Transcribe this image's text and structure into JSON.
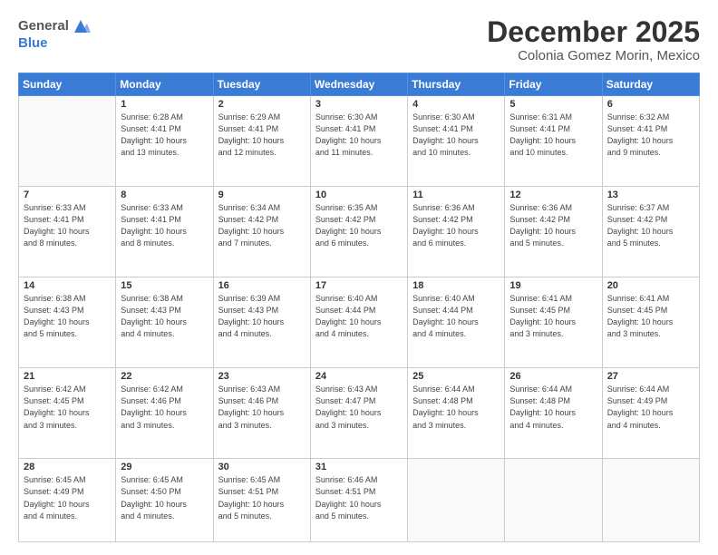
{
  "header": {
    "logo_general": "General",
    "logo_blue": "Blue",
    "month": "December 2025",
    "location": "Colonia Gomez Morin, Mexico"
  },
  "weekdays": [
    "Sunday",
    "Monday",
    "Tuesday",
    "Wednesday",
    "Thursday",
    "Friday",
    "Saturday"
  ],
  "weeks": [
    [
      {
        "day": "",
        "info": ""
      },
      {
        "day": "1",
        "info": "Sunrise: 6:28 AM\nSunset: 4:41 PM\nDaylight: 10 hours\nand 13 minutes."
      },
      {
        "day": "2",
        "info": "Sunrise: 6:29 AM\nSunset: 4:41 PM\nDaylight: 10 hours\nand 12 minutes."
      },
      {
        "day": "3",
        "info": "Sunrise: 6:30 AM\nSunset: 4:41 PM\nDaylight: 10 hours\nand 11 minutes."
      },
      {
        "day": "4",
        "info": "Sunrise: 6:30 AM\nSunset: 4:41 PM\nDaylight: 10 hours\nand 10 minutes."
      },
      {
        "day": "5",
        "info": "Sunrise: 6:31 AM\nSunset: 4:41 PM\nDaylight: 10 hours\nand 10 minutes."
      },
      {
        "day": "6",
        "info": "Sunrise: 6:32 AM\nSunset: 4:41 PM\nDaylight: 10 hours\nand 9 minutes."
      }
    ],
    [
      {
        "day": "7",
        "info": "Sunrise: 6:33 AM\nSunset: 4:41 PM\nDaylight: 10 hours\nand 8 minutes."
      },
      {
        "day": "8",
        "info": "Sunrise: 6:33 AM\nSunset: 4:41 PM\nDaylight: 10 hours\nand 8 minutes."
      },
      {
        "day": "9",
        "info": "Sunrise: 6:34 AM\nSunset: 4:42 PM\nDaylight: 10 hours\nand 7 minutes."
      },
      {
        "day": "10",
        "info": "Sunrise: 6:35 AM\nSunset: 4:42 PM\nDaylight: 10 hours\nand 6 minutes."
      },
      {
        "day": "11",
        "info": "Sunrise: 6:36 AM\nSunset: 4:42 PM\nDaylight: 10 hours\nand 6 minutes."
      },
      {
        "day": "12",
        "info": "Sunrise: 6:36 AM\nSunset: 4:42 PM\nDaylight: 10 hours\nand 5 minutes."
      },
      {
        "day": "13",
        "info": "Sunrise: 6:37 AM\nSunset: 4:42 PM\nDaylight: 10 hours\nand 5 minutes."
      }
    ],
    [
      {
        "day": "14",
        "info": "Sunrise: 6:38 AM\nSunset: 4:43 PM\nDaylight: 10 hours\nand 5 minutes."
      },
      {
        "day": "15",
        "info": "Sunrise: 6:38 AM\nSunset: 4:43 PM\nDaylight: 10 hours\nand 4 minutes."
      },
      {
        "day": "16",
        "info": "Sunrise: 6:39 AM\nSunset: 4:43 PM\nDaylight: 10 hours\nand 4 minutes."
      },
      {
        "day": "17",
        "info": "Sunrise: 6:40 AM\nSunset: 4:44 PM\nDaylight: 10 hours\nand 4 minutes."
      },
      {
        "day": "18",
        "info": "Sunrise: 6:40 AM\nSunset: 4:44 PM\nDaylight: 10 hours\nand 4 minutes."
      },
      {
        "day": "19",
        "info": "Sunrise: 6:41 AM\nSunset: 4:45 PM\nDaylight: 10 hours\nand 3 minutes."
      },
      {
        "day": "20",
        "info": "Sunrise: 6:41 AM\nSunset: 4:45 PM\nDaylight: 10 hours\nand 3 minutes."
      }
    ],
    [
      {
        "day": "21",
        "info": "Sunrise: 6:42 AM\nSunset: 4:45 PM\nDaylight: 10 hours\nand 3 minutes."
      },
      {
        "day": "22",
        "info": "Sunrise: 6:42 AM\nSunset: 4:46 PM\nDaylight: 10 hours\nand 3 minutes."
      },
      {
        "day": "23",
        "info": "Sunrise: 6:43 AM\nSunset: 4:46 PM\nDaylight: 10 hours\nand 3 minutes."
      },
      {
        "day": "24",
        "info": "Sunrise: 6:43 AM\nSunset: 4:47 PM\nDaylight: 10 hours\nand 3 minutes."
      },
      {
        "day": "25",
        "info": "Sunrise: 6:44 AM\nSunset: 4:48 PM\nDaylight: 10 hours\nand 3 minutes."
      },
      {
        "day": "26",
        "info": "Sunrise: 6:44 AM\nSunset: 4:48 PM\nDaylight: 10 hours\nand 4 minutes."
      },
      {
        "day": "27",
        "info": "Sunrise: 6:44 AM\nSunset: 4:49 PM\nDaylight: 10 hours\nand 4 minutes."
      }
    ],
    [
      {
        "day": "28",
        "info": "Sunrise: 6:45 AM\nSunset: 4:49 PM\nDaylight: 10 hours\nand 4 minutes."
      },
      {
        "day": "29",
        "info": "Sunrise: 6:45 AM\nSunset: 4:50 PM\nDaylight: 10 hours\nand 4 minutes."
      },
      {
        "day": "30",
        "info": "Sunrise: 6:45 AM\nSunset: 4:51 PM\nDaylight: 10 hours\nand 5 minutes."
      },
      {
        "day": "31",
        "info": "Sunrise: 6:46 AM\nSunset: 4:51 PM\nDaylight: 10 hours\nand 5 minutes."
      },
      {
        "day": "",
        "info": ""
      },
      {
        "day": "",
        "info": ""
      },
      {
        "day": "",
        "info": ""
      }
    ]
  ]
}
